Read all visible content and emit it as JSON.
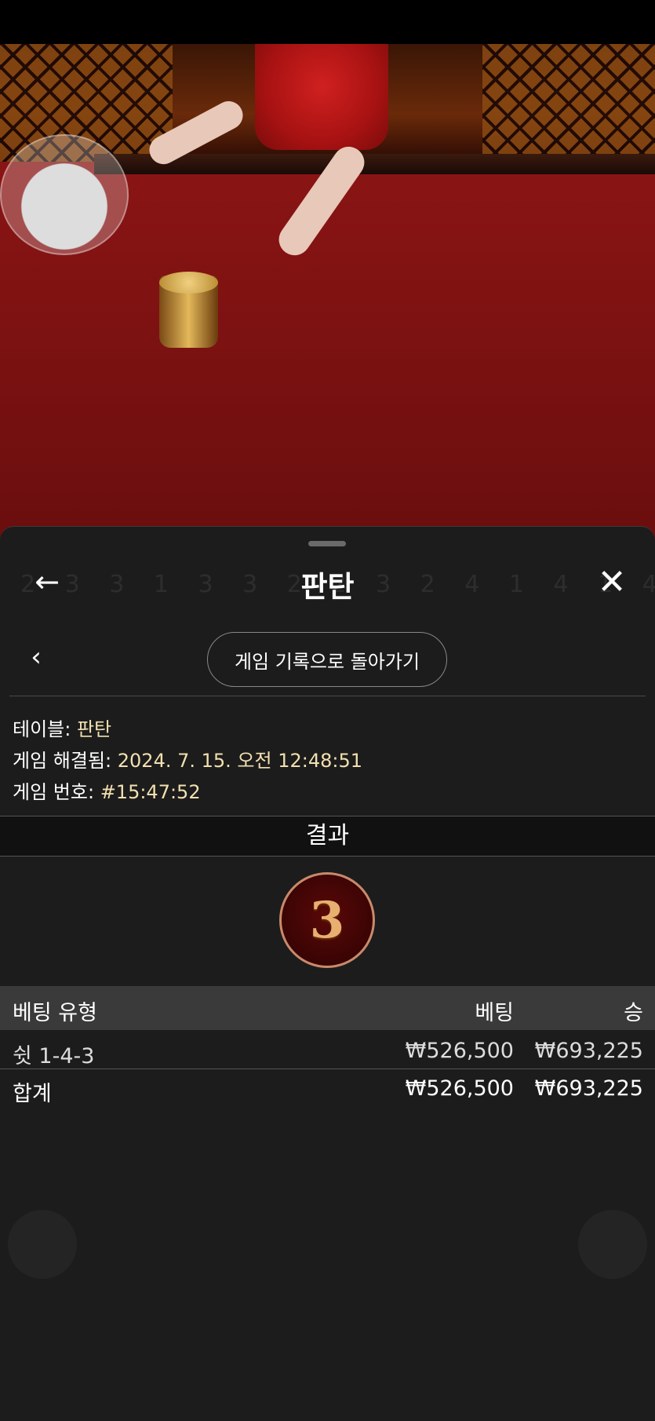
{
  "header": {
    "title": "판탄",
    "back_icon": "arrow-left-icon",
    "close_icon": "close-icon"
  },
  "nav": {
    "prev_icon": "chevron-left-icon",
    "history_button_label": "게임 기록으로 돌아가기"
  },
  "info": {
    "table_label": "테이블:",
    "table_value": "판탄",
    "resolved_label": "게임 해결됨:",
    "resolved_value": "2024. 7. 15. 오전 12:48:51",
    "game_number_label": "게임 번호:",
    "game_number_value": "#15:47:52"
  },
  "result": {
    "heading": "결과",
    "value": "3"
  },
  "bets": {
    "columns": [
      "베팅 유형",
      "베팅",
      "승"
    ],
    "rows": [
      {
        "type": "쉿 1-4-3",
        "bet": "₩526,500",
        "win": "₩693,225"
      }
    ],
    "total": {
      "label": "합계",
      "bet": "₩526,500",
      "win": "₩693,225"
    }
  },
  "colors": {
    "sheet_bg": "#1c1c1c",
    "table_header_bg": "#3a3a3a",
    "info_value": "#f2e0b0",
    "result_ball_border": "#c98a6a"
  }
}
